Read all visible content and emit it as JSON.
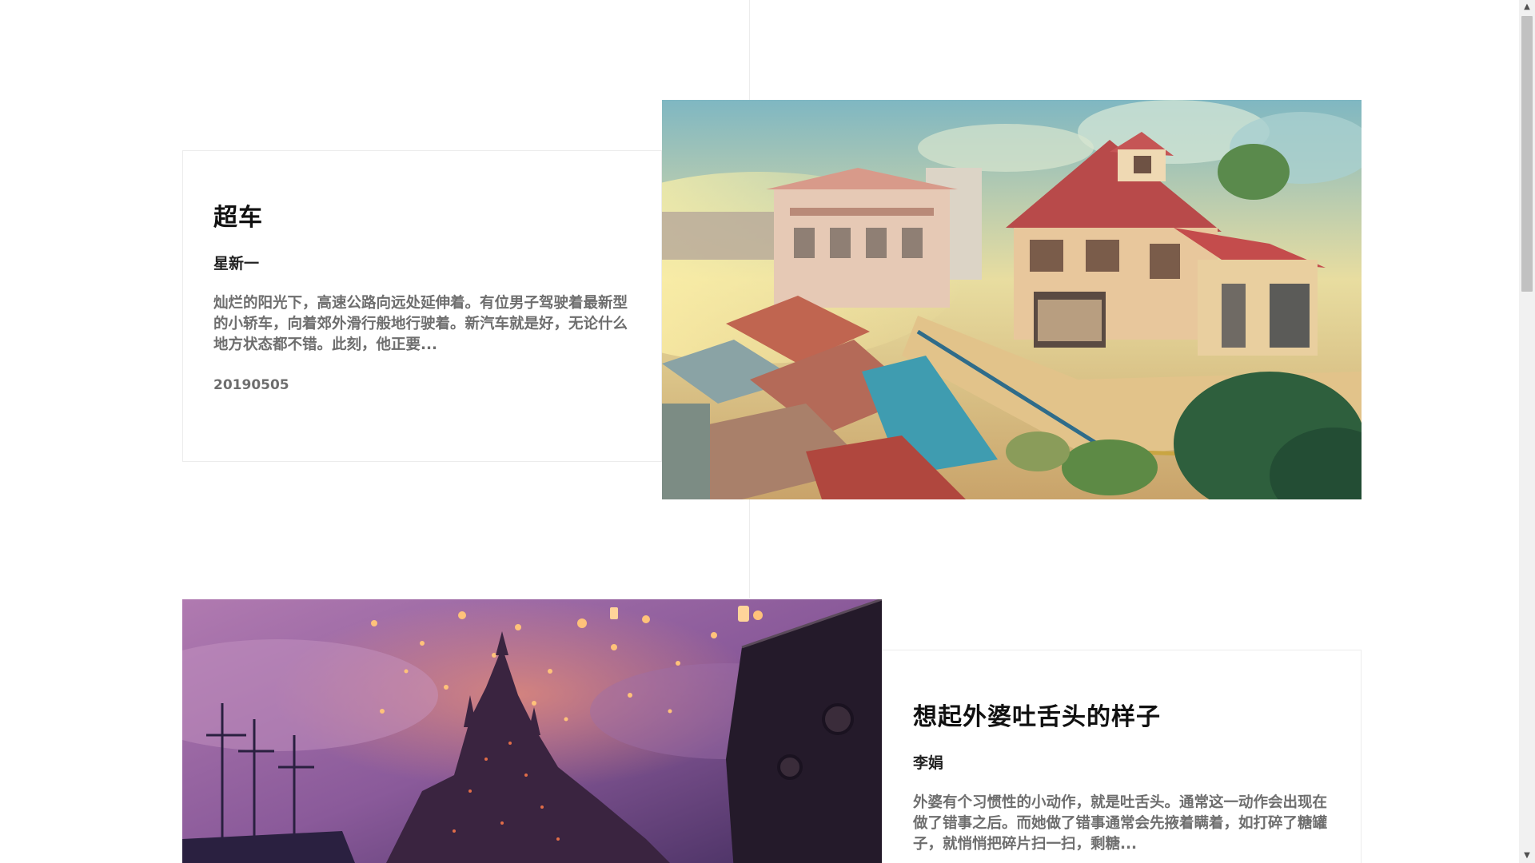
{
  "articles": [
    {
      "title": "超车",
      "author": "星新一",
      "excerpt": "灿烂的阳光下，高速公路向远处延伸着。有位男子驾驶着最新型的小轿车，向着郊外滑行般地行驶着。新汽车就是好，无论什么地方状态都不错。此刻，他正要...",
      "date": "20190505",
      "image": "painted-hillside-town-illustration"
    },
    {
      "title": "想起外婆吐舌头的样子",
      "author": "李娟",
      "excerpt": "外婆有个习惯性的小动作，就是吐舌头。通常这一动作会出现在做了错事之后。而她做了错事通常会先掖着瞒着，如打碎了糖罐子，就悄悄把碎片扫一扫，剩糖...",
      "image": "lantern-castle-night-illustration"
    }
  ],
  "scrollbar": {
    "up_arrow": "▲",
    "down_arrow": "▼",
    "position": 0
  },
  "colors": {
    "title": "#111111",
    "author": "#222222",
    "excerpt": "#6e6e6e",
    "border": "#ececec",
    "background": "#ffffff"
  }
}
